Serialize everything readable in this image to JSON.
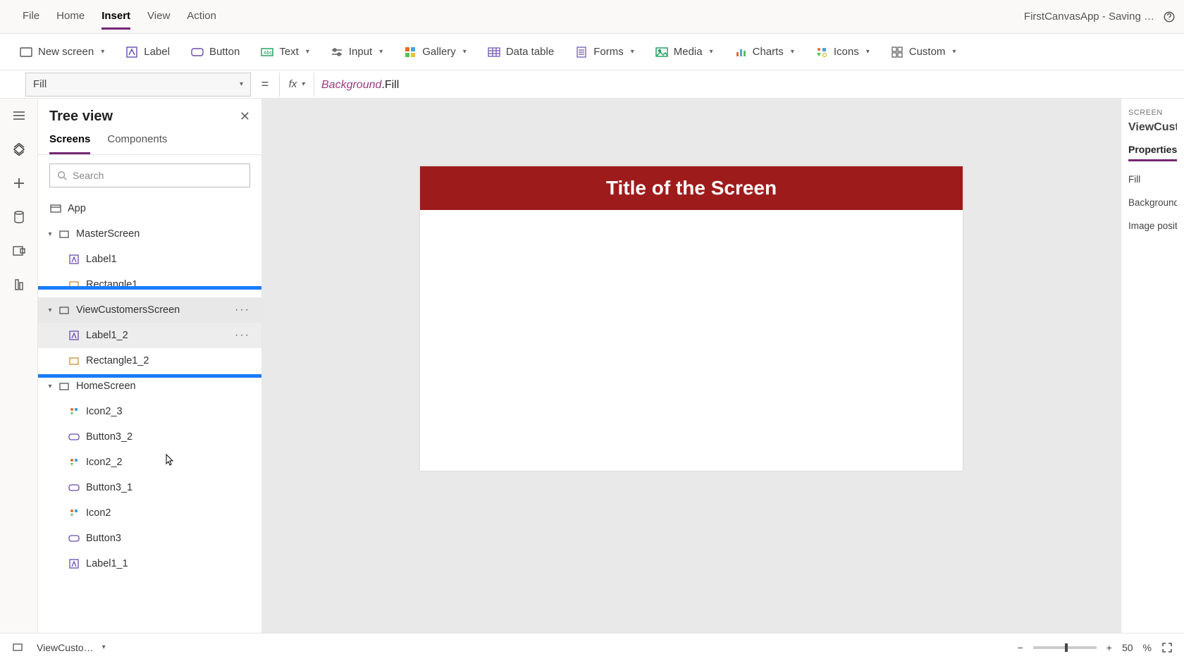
{
  "topMenu": {
    "items": [
      "File",
      "Home",
      "Insert",
      "View",
      "Action"
    ],
    "activeIndex": 2,
    "appStatus": "FirstCanvasApp - Saving …"
  },
  "ribbon": {
    "newScreen": "New screen",
    "label": "Label",
    "button": "Button",
    "text": "Text",
    "input": "Input",
    "gallery": "Gallery",
    "dataTable": "Data table",
    "forms": "Forms",
    "media": "Media",
    "charts": "Charts",
    "icons": "Icons",
    "custom": "Custom"
  },
  "formula": {
    "property": "Fill",
    "fx": "fx",
    "exprItalic": "Background",
    "exprPlain": ".Fill"
  },
  "treeView": {
    "title": "Tree view",
    "tabs": {
      "screens": "Screens",
      "components": "Components"
    },
    "searchPlaceholder": "Search",
    "appNode": "App",
    "screens": [
      {
        "name": "MasterScreen",
        "children": [
          "Label1",
          "Rectangle1"
        ]
      },
      {
        "name": "ViewCustomersScreen",
        "children": [
          "Label1_2",
          "Rectangle1_2"
        ],
        "selected": true
      },
      {
        "name": "HomeScreen",
        "children": [
          "Icon2_3",
          "Button3_2",
          "Icon2_2",
          "Button3_1",
          "Icon2",
          "Button3",
          "Label1_1"
        ]
      }
    ]
  },
  "canvas": {
    "screenTitle": "Title of the Screen"
  },
  "rightPanel": {
    "typeLabel": "SCREEN",
    "name": "ViewCusto",
    "tab": "Properties",
    "props": [
      "Fill",
      "Background",
      "Image posit"
    ]
  },
  "statusBar": {
    "selected": "ViewCusto…",
    "zoom": "50",
    "zoomUnit": "%"
  }
}
